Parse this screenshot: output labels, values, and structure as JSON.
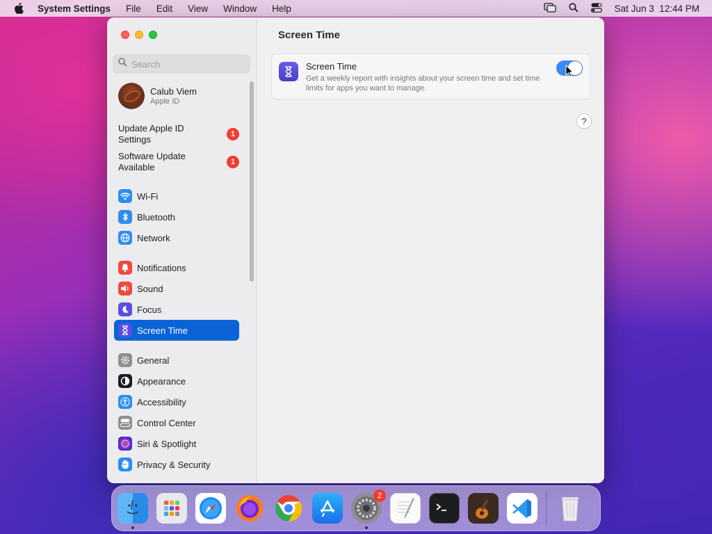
{
  "menubar": {
    "app_name": "System Settings",
    "menus": [
      "File",
      "Edit",
      "View",
      "Window",
      "Help"
    ],
    "datetime": "Sat Jun 3  12:44 PM"
  },
  "sidebar": {
    "search_placeholder": "Search",
    "account": {
      "name": "Calub Viem",
      "subtitle": "Apple ID"
    },
    "alerts": [
      {
        "label": "Update Apple ID Settings",
        "badge": "1"
      },
      {
        "label": "Software Update Available",
        "badge": "1"
      }
    ],
    "items": [
      {
        "label": "Wi-Fi",
        "icon": "wifi-icon",
        "color": "#2d8cf0"
      },
      {
        "label": "Bluetooth",
        "icon": "bluetooth-icon",
        "color": "#2d8cf0"
      },
      {
        "label": "Network",
        "icon": "globe-icon",
        "color": "#2d8cf0"
      },
      {
        "label": "Notifications",
        "icon": "bell-icon",
        "color": "#f2493f"
      },
      {
        "label": "Sound",
        "icon": "speaker-icon",
        "color": "#f2493f"
      },
      {
        "label": "Focus",
        "icon": "moon-icon",
        "color": "#5b4ee0"
      },
      {
        "label": "Screen Time",
        "icon": "hourglass-icon",
        "color": "#5b4ee0",
        "selected": true
      },
      {
        "label": "General",
        "icon": "gear-icon",
        "color": "#8e8e93"
      },
      {
        "label": "Appearance",
        "icon": "appearance-icon",
        "color": "#1d1d1f"
      },
      {
        "label": "Accessibility",
        "icon": "accessibility-icon",
        "color": "#2d8cf0"
      },
      {
        "label": "Control Center",
        "icon": "control-center-icon",
        "color": "#8e8e93"
      },
      {
        "label": "Siri & Spotlight",
        "icon": "siri-icon",
        "color": "#6a2ad0"
      },
      {
        "label": "Privacy & Security",
        "icon": "hand-icon",
        "color": "#2d8cf0"
      }
    ]
  },
  "main": {
    "title": "Screen Time",
    "card": {
      "title": "Screen Time",
      "description": "Get a weekly report with insights about your screen time and set time limits for apps you want to manage.",
      "toggle_on": true
    },
    "help_label": "?"
  },
  "dock": {
    "apps": [
      "Finder",
      "Launchpad",
      "Safari",
      "Firefox",
      "Chrome",
      "App Store",
      "System Settings",
      "TextEdit",
      "Terminal",
      "GarageBand",
      "VS Code"
    ],
    "system_settings_badge": "2"
  }
}
